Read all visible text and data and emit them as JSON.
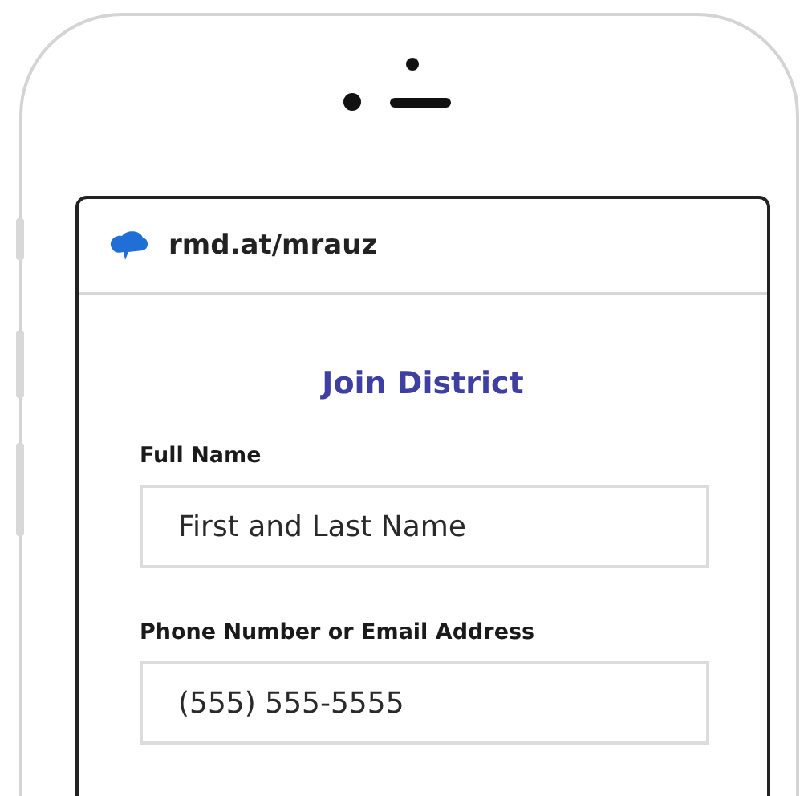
{
  "address_bar": {
    "url": "rmd.at/mrauz"
  },
  "form": {
    "title": "Join District",
    "fields": [
      {
        "label": "Full Name",
        "placeholder": "First and Last Name"
      },
      {
        "label": "Phone Number or Email Address",
        "placeholder": "(555) 555-5555"
      }
    ]
  }
}
